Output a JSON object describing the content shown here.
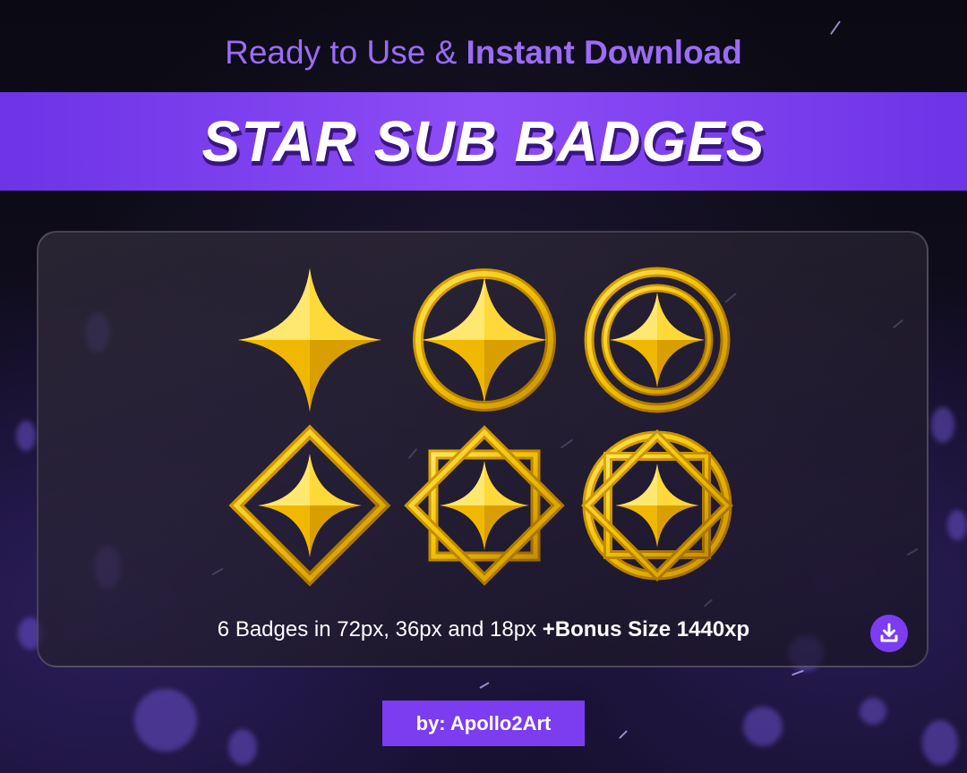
{
  "header": {
    "subtitle_part1": "Ready to Use & ",
    "subtitle_part2": "Instant Download",
    "title": "STAR SUB BADGES"
  },
  "badges": [
    {
      "name": "star-badge",
      "variant": "star"
    },
    {
      "name": "star-in-circle-badge",
      "variant": "circle"
    },
    {
      "name": "star-in-double-circle-badge",
      "variant": "double-circle"
    },
    {
      "name": "star-in-diamond-badge",
      "variant": "diamond"
    },
    {
      "name": "star-in-diamond-square-badge",
      "variant": "diamond-square"
    },
    {
      "name": "star-in-circle-diamond-square-badge",
      "variant": "circle-diamond-square"
    }
  ],
  "info": {
    "text": "6 Badges in 72px, 36px and 18px ",
    "bonus": "+Bonus Size 1440xp"
  },
  "download_icon": "download-icon",
  "author": "by: Apollo2Art",
  "colors": {
    "accent": "#7c3cf0",
    "subtitle": "#9b6cf5",
    "gold": "#f5c400",
    "background": "#0d0a17"
  }
}
